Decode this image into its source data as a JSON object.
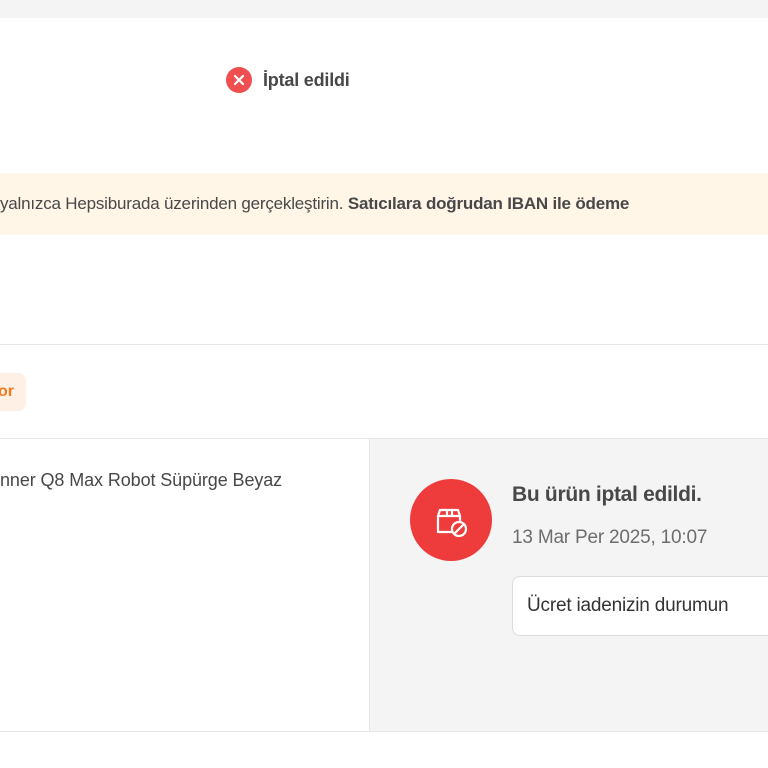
{
  "order": {
    "status_text": "İptal edildi",
    "status_icon": "x-circle-icon",
    "status_color": "#ef4f4f"
  },
  "warning": {
    "text": "yalnızca Hepsiburada üzerinden gerçekleştirin.",
    "bold_text": "Satıcılara doğrudan IBAN ile ödeme"
  },
  "tag": {
    "label": "or",
    "color": "#f27a1a"
  },
  "product": {
    "name": "nner Q8 Max Robot Süpürge Beyaz"
  },
  "cancellation": {
    "icon": "cancelled-package-icon",
    "title": "Bu ürün iptal edildi.",
    "date": "13 Mar Per 2025, 10:07",
    "refund_button_label": "Ücret iadenizin durumun"
  },
  "colors": {
    "accent": "#f27a1a",
    "danger": "#ee3c3c",
    "banner_bg": "#fff6e8"
  }
}
